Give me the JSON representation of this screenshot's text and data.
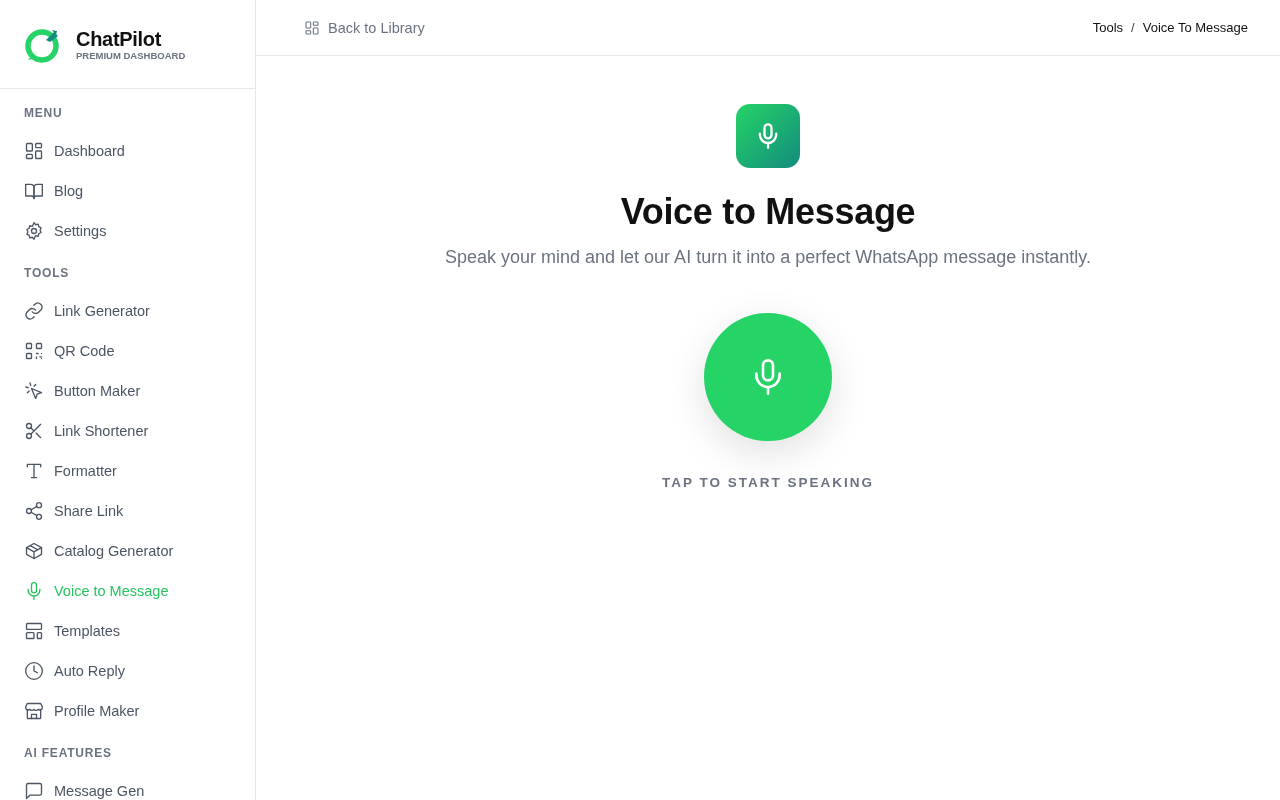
{
  "brand": {
    "name": "ChatPilot",
    "tagline": "PREMIUM DASHBOARD"
  },
  "sidebar": {
    "sections": [
      {
        "title": "MENU",
        "items": [
          {
            "label": "Dashboard",
            "selected": false
          },
          {
            "label": "Blog",
            "selected": false
          },
          {
            "label": "Settings",
            "selected": false
          }
        ]
      },
      {
        "title": "TOOLS",
        "items": [
          {
            "label": "Link Generator",
            "selected": false
          },
          {
            "label": "QR Code",
            "selected": false
          },
          {
            "label": "Button Maker",
            "selected": false
          },
          {
            "label": "Link Shortener",
            "selected": false
          },
          {
            "label": "Formatter",
            "selected": false
          },
          {
            "label": "Share Link",
            "selected": false
          },
          {
            "label": "Catalog Generator",
            "selected": false
          },
          {
            "label": "Voice to Message",
            "selected": true
          },
          {
            "label": "Templates",
            "selected": false
          },
          {
            "label": "Auto Reply",
            "selected": false
          },
          {
            "label": "Profile Maker",
            "selected": false
          }
        ]
      },
      {
        "title": "AI FEATURES",
        "items": [
          {
            "label": "Message Gen",
            "selected": false
          }
        ]
      }
    ]
  },
  "header": {
    "back_link": "Back to Library",
    "breadcrumb": [
      "Tools",
      "Voice To Message"
    ],
    "breadcrumb_separator": "/"
  },
  "main": {
    "title": "Voice to Message",
    "subtitle": "Speak your mind and let our AI turn it into a perfect WhatsApp message instantly.",
    "record_label": "TAP TO START SPEAKING"
  }
}
